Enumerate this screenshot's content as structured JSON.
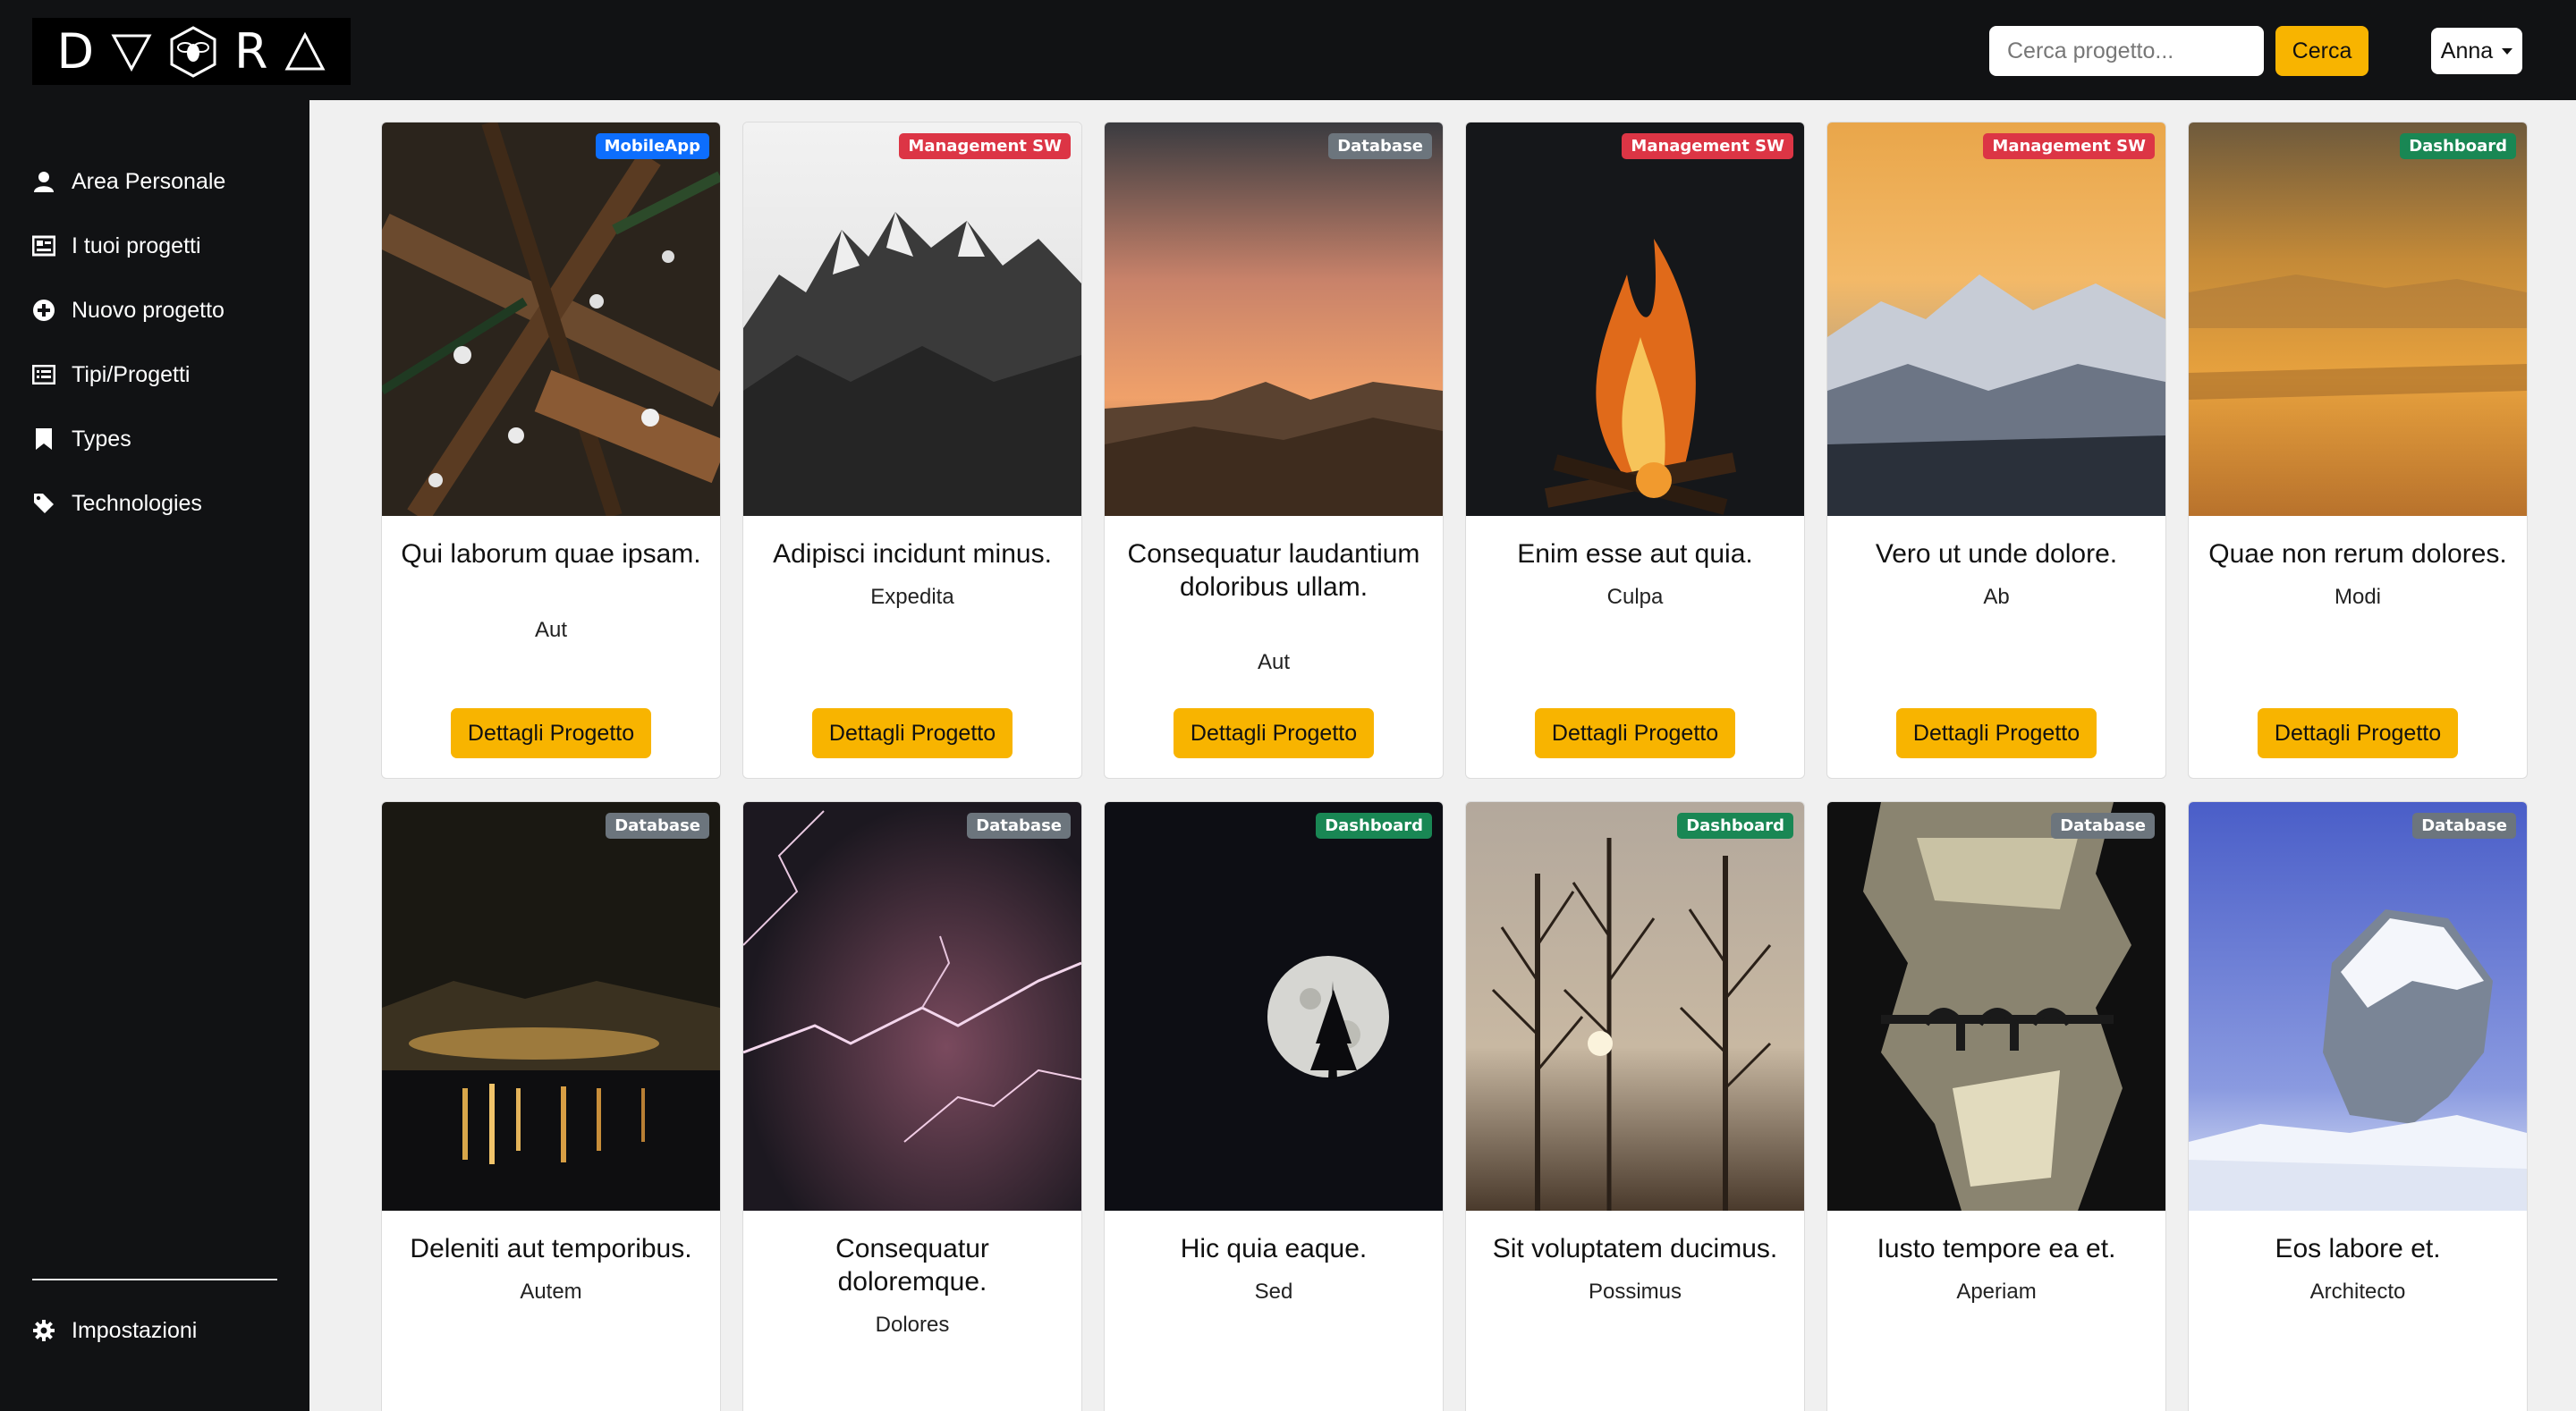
{
  "header": {
    "logo_letters": [
      "D",
      "R"
    ],
    "search_placeholder": "Cerca progetto...",
    "search_button": "Cerca",
    "user_name": "Anna"
  },
  "sidebar": {
    "items": [
      {
        "label": "Area Personale",
        "icon": "user-icon"
      },
      {
        "label": "I tuoi progetti",
        "icon": "image-list-icon"
      },
      {
        "label": "Nuovo progetto",
        "icon": "plus-circle-icon"
      },
      {
        "label": "Tipi/Progetti",
        "icon": "list-icon"
      },
      {
        "label": "Types",
        "icon": "bookmark-icon"
      },
      {
        "label": "Technologies",
        "icon": "tag-icon"
      }
    ],
    "settings": {
      "label": "Impostazioni",
      "icon": "gear-icon"
    }
  },
  "badge_colors": {
    "MobileApp": "#0d6efd",
    "Management SW": "#dc3545",
    "Database": "#6c757d",
    "Dashboard": "#198754"
  },
  "cards": [
    {
      "title": "Qui laborum quae ipsam.",
      "subtitle": "Aut",
      "badge": "MobileApp",
      "button": "Dettagli Progetto"
    },
    {
      "title": "Adipisci incidunt minus.",
      "subtitle": "Expedita",
      "badge": "Management SW",
      "button": "Dettagli Progetto"
    },
    {
      "title": "Consequatur laudantium doloribus ullam.",
      "subtitle": "Aut",
      "badge": "Database",
      "button": "Dettagli Progetto"
    },
    {
      "title": "Enim esse aut quia.",
      "subtitle": "Culpa",
      "badge": "Management SW",
      "button": "Dettagli Progetto"
    },
    {
      "title": "Vero ut unde dolore.",
      "subtitle": "Ab",
      "badge": "Management SW",
      "button": "Dettagli Progetto"
    },
    {
      "title": "Quae non rerum dolores.",
      "subtitle": "Modi",
      "badge": "Dashboard",
      "button": "Dettagli Progetto"
    },
    {
      "title": "Deleniti aut temporibus.",
      "subtitle": "Autem",
      "badge": "Database"
    },
    {
      "title": "Consequatur doloremque.",
      "subtitle": "Dolores",
      "badge": "Database"
    },
    {
      "title": "Hic quia eaque.",
      "subtitle": "Sed",
      "badge": "Dashboard"
    },
    {
      "title": "Sit voluptatem ducimus.",
      "subtitle": "Possimus",
      "badge": "Dashboard"
    },
    {
      "title": "Iusto tempore ea et.",
      "subtitle": "Aperiam",
      "badge": "Database"
    },
    {
      "title": "Eos labore et.",
      "subtitle": "Architecto",
      "badge": "Database"
    }
  ]
}
